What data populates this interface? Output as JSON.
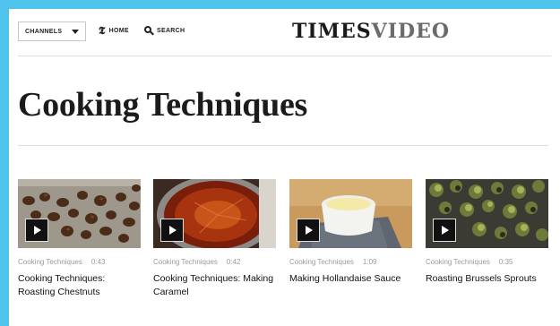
{
  "header": {
    "channels_label": "CHANNELS",
    "home_label": "HOME",
    "search_label": "SEARCH",
    "brand_part1": "TIMES",
    "brand_part2": "VIDEO"
  },
  "page_title": "Cooking Techniques",
  "videos": [
    {
      "channel": "Cooking Techniques",
      "duration": "0:43",
      "title": "Cooking Techniques: Roasting Chestnuts",
      "thumbnail": "roasted-chestnuts-on-tray"
    },
    {
      "channel": "Cooking Techniques",
      "duration": "0:42",
      "title": "Cooking Techniques: Making Caramel",
      "thumbnail": "caramel-in-saucepan"
    },
    {
      "channel": "Cooking Techniques",
      "duration": "1:09",
      "title": "Making Hollandaise Sauce",
      "thumbnail": "hollandaise-in-ramekin"
    },
    {
      "channel": "Cooking Techniques",
      "duration": "0:35",
      "title": "Roasting Brussels Sprouts",
      "thumbnail": "brussels-sprouts-on-tray"
    }
  ],
  "colors": {
    "frame": "#4fc3ec",
    "background": "#ffffff",
    "meta_text": "#9a9a9a",
    "brand_dark": "#1a1a1a",
    "brand_light": "#6b6b6b"
  },
  "icons": [
    "chevron-down-icon",
    "nyt-t-logo-icon",
    "search-icon",
    "play-icon"
  ]
}
